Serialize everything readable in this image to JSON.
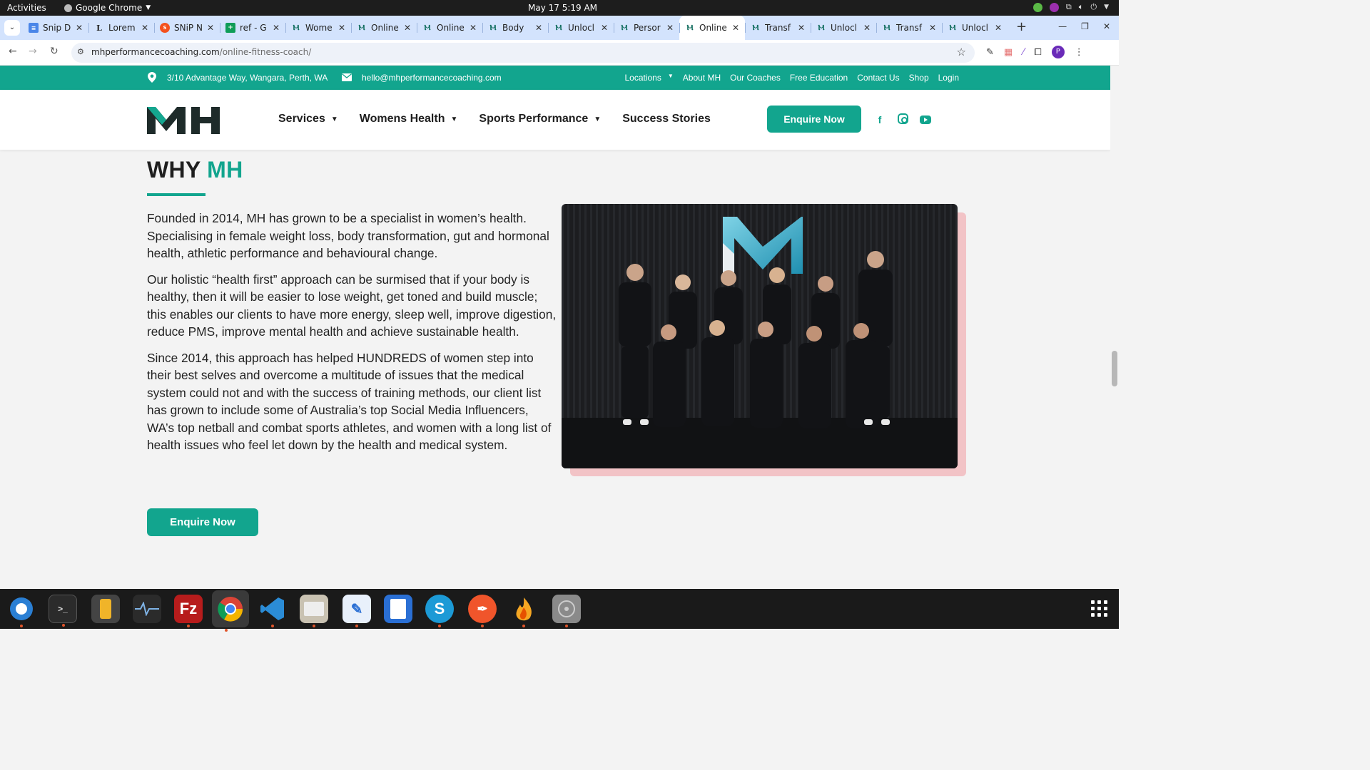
{
  "system": {
    "activities": "Activities",
    "app_name": "Google Chrome",
    "clock": "May 17  5:19 AM"
  },
  "browser": {
    "tabs": [
      {
        "title": "Snip D",
        "favicon": "docs-icon"
      },
      {
        "title": "Lorem",
        "favicon": "lorem-icon"
      },
      {
        "title": "SNiP N",
        "favicon": "snip-icon"
      },
      {
        "title": "ref - G",
        "favicon": "sheets-icon"
      },
      {
        "title": "Wome",
        "favicon": "mh-icon"
      },
      {
        "title": "Online",
        "favicon": "mh-icon"
      },
      {
        "title": "Online",
        "favicon": "mh-icon"
      },
      {
        "title": "Body",
        "favicon": "mh-icon"
      },
      {
        "title": "Unlocl",
        "favicon": "mh-icon"
      },
      {
        "title": "Persor",
        "favicon": "mh-icon"
      },
      {
        "title": "Online",
        "favicon": "mh-icon",
        "active": true
      },
      {
        "title": "Transf",
        "favicon": "mh-icon"
      },
      {
        "title": "Unlocl",
        "favicon": "mh-icon"
      },
      {
        "title": "Transf",
        "favicon": "mh-icon"
      },
      {
        "title": "Unlocl",
        "favicon": "mh-icon"
      }
    ],
    "url_domain": "mhperformancecoaching.com",
    "url_path": "/online-fitness-coach/",
    "profile_initial": "P"
  },
  "site": {
    "brand_color": "#12a58e",
    "topbar": {
      "address": "3/10 Advantage Way, Wangara, Perth, WA",
      "email": "hello@mhperformancecoaching.com",
      "links": [
        "Locations",
        "About MH",
        "Our Coaches",
        "Free Education",
        "Contact Us",
        "Shop",
        "Login"
      ]
    },
    "nav": {
      "services": "Services",
      "womens_health": "Womens Health",
      "sports_performance": "Sports Performance",
      "success_stories": "Success Stories",
      "enquire": "Enquire Now"
    },
    "social": [
      "facebook-icon",
      "instagram-icon",
      "youtube-icon"
    ]
  },
  "section": {
    "heading_a": "WHY ",
    "heading_b": "MH",
    "paragraphs": [
      "Founded in 2014, MH has grown to be a specialist in women’s health. Specialising in female weight loss, body transformation, gut and hormonal health, athletic performance and behavioural change.",
      "Our holistic “health first” approach can be surmised that if your body is healthy, then it will be easier to lose weight, get toned and build muscle; this enables our clients to have more energy, sleep well, improve digestion, reduce PMS, improve mental health and achieve sustainable health.",
      "Since 2014, this approach has helped HUNDREDS of women step into their best selves and overcome a multitude of issues that the medical system could not and with the success of training methods, our client list has grown to include some of Australia’s top Social Media Influencers, WA’s top netball and combat sports athletes, and women with a long list of health issues who feel let down by the health and medical system."
    ],
    "cta": "Enquire Now"
  },
  "dock": [
    "thunderbird-icon",
    "terminal-icon",
    "calculator-icon",
    "system-monitor-icon",
    "filezilla-icon",
    "chrome-icon",
    "vscode-icon",
    "files-icon",
    "text-editor-icon",
    "writer-icon",
    "skype-icon",
    "inkscape-icon",
    "burner-icon",
    "disc-icon"
  ]
}
